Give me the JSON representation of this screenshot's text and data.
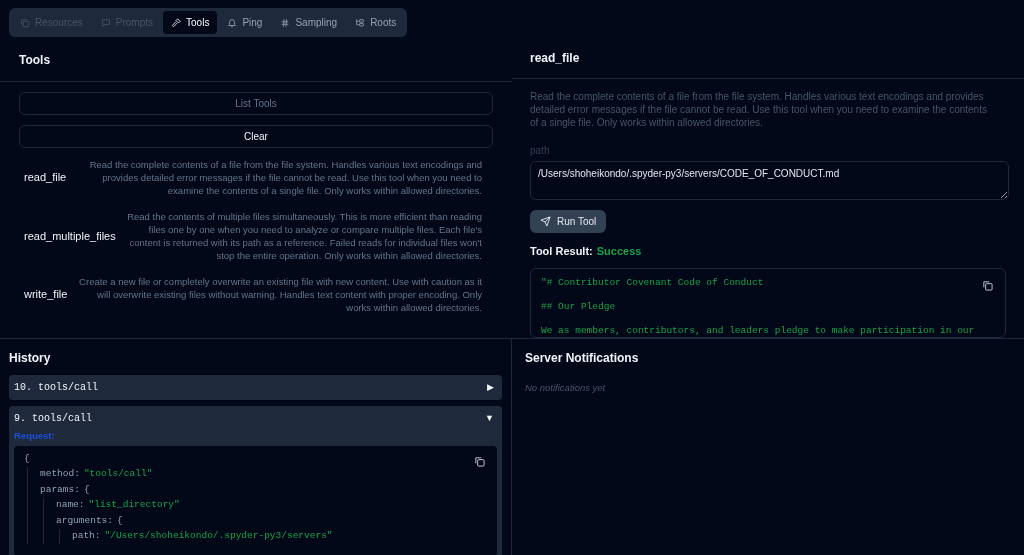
{
  "tabs": [
    {
      "label": "Resources",
      "selected": false,
      "disabled": true
    },
    {
      "label": "Prompts",
      "selected": false,
      "disabled": true
    },
    {
      "label": "Tools",
      "selected": true,
      "disabled": false
    },
    {
      "label": "Ping",
      "selected": false,
      "disabled": false
    },
    {
      "label": "Sampling",
      "selected": false,
      "disabled": false
    },
    {
      "label": "Roots",
      "selected": false,
      "disabled": false
    }
  ],
  "tools_panel": {
    "title": "Tools",
    "buttons": [
      {
        "label": "List Tools",
        "disabled": true
      },
      {
        "label": "Clear",
        "disabled": false
      }
    ],
    "tools": [
      {
        "name": "read_file",
        "description": "Read the complete contents of a file from the file system. Handles various text encodings and provides detailed error messages if the file cannot be read. Use this tool when you need to examine the contents of a single file. Only works within allowed directories."
      },
      {
        "name": "read_multiple_files",
        "description": "Read the contents of multiple files simultaneously. This is more efficient than reading files one by one when you need to analyze or compare multiple files. Each file's content is returned with its path as a reference. Failed reads for individual files won't stop the entire operation. Only works within allowed directories."
      },
      {
        "name": "write_file",
        "description": "Create a new file or completely overwrite an existing file with new content. Use with caution as it will overwrite existing files without warning. Handles text content with proper encoding. Only works within allowed directories."
      }
    ]
  },
  "tool_detail": {
    "title": "read_file",
    "description": "Read the complete contents of a file from the file system. Handles various text encodings and provides detailed error messages if the file cannot be read. Use this tool when you need to examine the contents of a single file. Only works within allowed directories.",
    "field_label": "path",
    "field_value": "/Users/shoheikondo/.spyder-py3/servers/CODE_OF_CONDUCT.md",
    "run_button": "Run Tool",
    "result_label": "Tool Result:",
    "result_status": "Success",
    "result_lines": [
      "\"# Contributor Covenant Code of Conduct",
      "## Our Pledge",
      "We as members, contributors, and leaders pledge to make participation in our"
    ]
  },
  "history": {
    "title": "History",
    "items": [
      {
        "label": "10. tools/call",
        "expanded": false,
        "toggle": "▶"
      },
      {
        "label": "9. tools/call",
        "expanded": true,
        "toggle": "▼",
        "request_label": "Request:",
        "request": {
          "open": "{",
          "children": [
            {
              "key": "method:",
              "value": "\"tools/call\""
            },
            {
              "key": "params:",
              "open": "{",
              "children": [
                {
                  "key": "name:",
                  "value": "\"list_directory\""
                },
                {
                  "key": "arguments:",
                  "open": "{",
                  "children": [
                    {
                      "key": "path:",
                      "value": "\"/Users/shoheikondo/.spyder-py3/servers\""
                    }
                  ]
                }
              ]
            }
          ]
        }
      }
    ]
  },
  "notifications": {
    "title": "Server Notifications",
    "empty": "No notifications yet"
  }
}
